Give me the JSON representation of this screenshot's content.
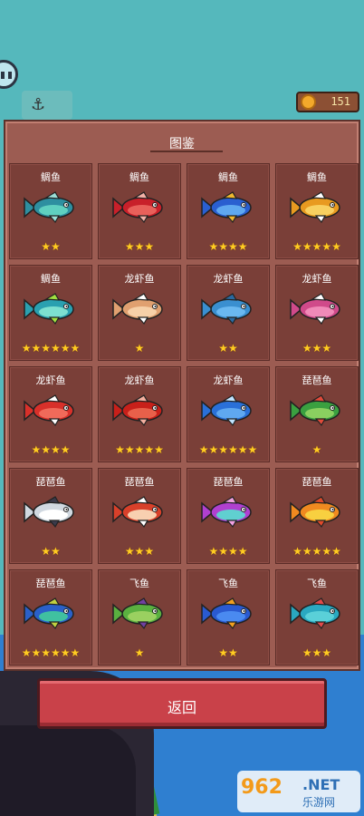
{
  "wallet": {
    "coins": "151",
    "coin_icon": "gold-coin-icon"
  },
  "panel": {
    "title": "图鉴"
  },
  "return_button": {
    "label": "返回"
  },
  "watermark": {
    "logo": "962",
    "domain": ".NET",
    "subtitle": "乐游网"
  },
  "fish_cards": [
    {
      "name": "鲷鱼",
      "stars": 2,
      "colors": [
        "#2e8fa0",
        "#5fd0c0",
        "#9bded6"
      ]
    },
    {
      "name": "鲷鱼",
      "stars": 3,
      "colors": [
        "#c8202a",
        "#e8605a",
        "#f3b2a8"
      ]
    },
    {
      "name": "鲷鱼",
      "stars": 4,
      "colors": [
        "#2a5fd0",
        "#5fa8f0",
        "#f0b830"
      ]
    },
    {
      "name": "鲷鱼",
      "stars": 5,
      "colors": [
        "#e89a20",
        "#f8d060",
        "#ffffff"
      ]
    },
    {
      "name": "鲷鱼",
      "stars": 6,
      "colors": [
        "#2aa0b0",
        "#7de0d0",
        "#a0e040"
      ]
    },
    {
      "name": "龙虾鱼",
      "stars": 1,
      "colors": [
        "#e0a070",
        "#f6d0a8",
        "#ffffff"
      ]
    },
    {
      "name": "龙虾鱼",
      "stars": 2,
      "colors": [
        "#3a8fd0",
        "#6ab8f0",
        "#2a6aa0"
      ]
    },
    {
      "name": "龙虾鱼",
      "stars": 3,
      "colors": [
        "#d04a8a",
        "#f08ab8",
        "#ffffff"
      ]
    },
    {
      "name": "龙虾鱼",
      "stars": 4,
      "colors": [
        "#d8302a",
        "#f06a5a",
        "#ffffff"
      ]
    },
    {
      "name": "龙虾鱼",
      "stars": 5,
      "colors": [
        "#c8201a",
        "#e8604a",
        "#f4b0a0"
      ]
    },
    {
      "name": "龙虾鱼",
      "stars": 6,
      "colors": [
        "#2a70d8",
        "#5fa8f0",
        "#c0e4ff"
      ]
    },
    {
      "name": "琵琶鱼",
      "stars": 1,
      "colors": [
        "#3aa040",
        "#8ad060",
        "#e04a3a"
      ]
    },
    {
      "name": "琵琶鱼",
      "stars": 2,
      "colors": [
        "#d0d8e0",
        "#ffffff",
        "#3a3a4a"
      ]
    },
    {
      "name": "琵琶鱼",
      "stars": 3,
      "colors": [
        "#d8402a",
        "#f8d0b0",
        "#ffffff"
      ]
    },
    {
      "name": "琵琶鱼",
      "stars": 4,
      "colors": [
        "#b040d0",
        "#60d0d0",
        "#f0a0e0"
      ]
    },
    {
      "name": "琵琶鱼",
      "stars": 5,
      "colors": [
        "#f08a20",
        "#f8d040",
        "#e04a2a"
      ]
    },
    {
      "name": "琵琶鱼",
      "stars": 6,
      "colors": [
        "#2a60c8",
        "#40c0a0",
        "#c0d040"
      ]
    },
    {
      "name": "飞鱼",
      "stars": 1,
      "colors": [
        "#5ab040",
        "#9ad060",
        "#7040a0"
      ]
    },
    {
      "name": "飞鱼",
      "stars": 2,
      "colors": [
        "#2a5ad0",
        "#4a8af0",
        "#f0a020"
      ]
    },
    {
      "name": "飞鱼",
      "stars": 3,
      "colors": [
        "#2aa8c0",
        "#5ad0d8",
        "#e04a4a"
      ]
    }
  ]
}
